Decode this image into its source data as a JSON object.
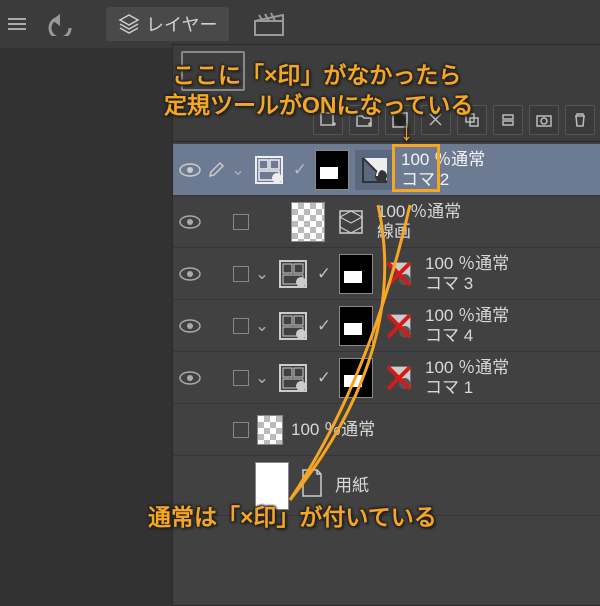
{
  "toolbar": {
    "tab_label": "レイヤー"
  },
  "layers": {
    "sel": {
      "opacity": "100 ％通常",
      "name": "コマ 2"
    },
    "l2": {
      "opacity": "100 ％通常",
      "name": "線画"
    },
    "l3": {
      "opacity": "100 ％通常",
      "name": "コマ 3"
    },
    "l4": {
      "opacity": "100 ％通常",
      "name": "コマ 4"
    },
    "l5": {
      "opacity": "100 ％通常",
      "name": "コマ 1"
    },
    "l6": {
      "opacity": "100 ％通常",
      "name": ""
    },
    "paper": {
      "name": "用紙"
    }
  },
  "annot": {
    "top1": "ここに「×印」がなかったら",
    "top2": "定規ツールがONになっている",
    "arrow": "↓",
    "bottom": "通常は「×印」が付いている"
  },
  "icons": {
    "ruler_enabled_desc": "ruler icon without X means ruler active",
    "x_meaning": "x mark over ruler icon"
  }
}
